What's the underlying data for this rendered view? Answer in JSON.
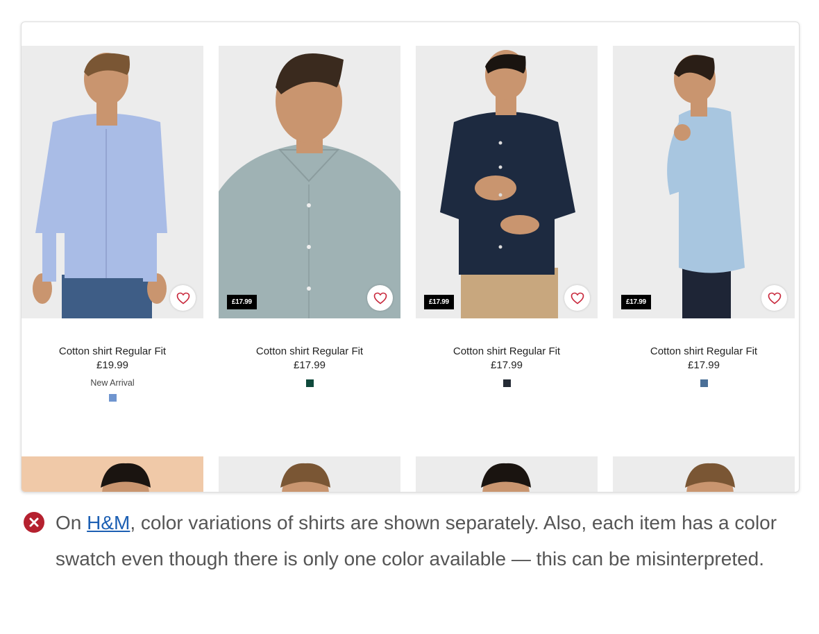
{
  "products": [
    {
      "name": "Cotton shirt Regular Fit",
      "price": "£19.99",
      "price_tag": "",
      "marker": "New Arrival",
      "swatch_color": "#6f95cf",
      "shirt_color": "#a9bce6",
      "bg_color": "#ececec"
    },
    {
      "name": "Cotton shirt Regular Fit",
      "price": "£17.99",
      "price_tag": "£17.99",
      "marker": "",
      "swatch_color": "#0f4a3c",
      "shirt_color": "#9fb2b4",
      "bg_color": "#ececec"
    },
    {
      "name": "Cotton shirt Regular Fit",
      "price": "£17.99",
      "price_tag": "£17.99",
      "marker": "",
      "swatch_color": "#252b35",
      "shirt_color": "#1d2a40",
      "bg_color": "#ececec"
    },
    {
      "name": "Cotton shirt Regular Fit",
      "price": "£17.99",
      "price_tag": "£17.99",
      "marker": "",
      "swatch_color": "#4a6f97",
      "shirt_color": "#a8c6e0",
      "bg_color": "#ececec"
    }
  ],
  "second_row_bg": [
    "#f0c9a8",
    "#ececec",
    "#ececec",
    "#ececec"
  ],
  "caption": {
    "icon": "error-x-circle-icon",
    "icon_color": "#b5212f",
    "prefix": "On ",
    "link_text": "H&M",
    "suffix": ", color variations of shirts are shown separately. Also, each item has a color swatch even though there is only one color available — this can be misinterpreted."
  }
}
